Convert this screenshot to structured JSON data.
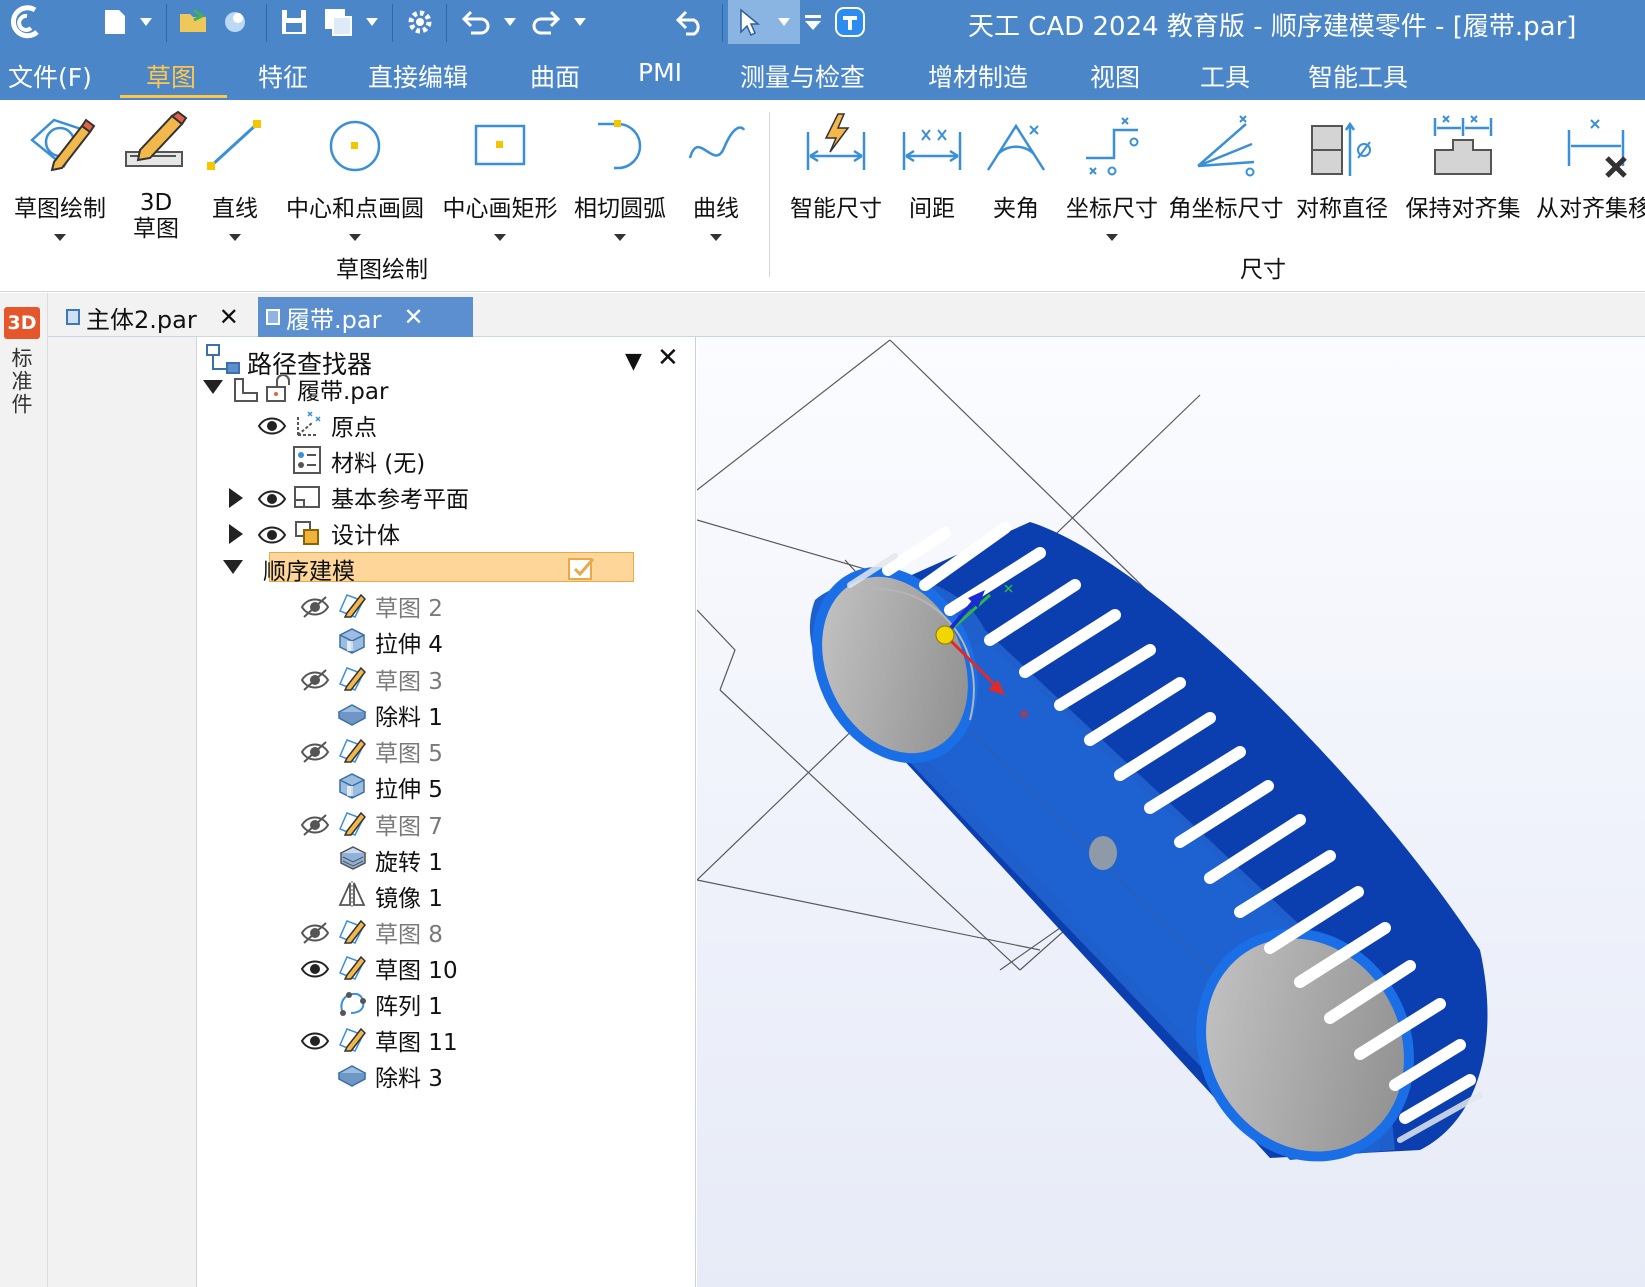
{
  "titlebar": {
    "title": "天工 CAD 2024 教育版 - 顺序建模零件 - [履带.par]",
    "icons": [
      "app-logo-icon",
      "new-file-icon",
      "open-file-icon",
      "shared-icon",
      "save-icon",
      "save-as-icon",
      "settings-icon",
      "undo-icon",
      "redo-icon",
      "return-icon",
      "select-pointer-icon",
      "customize-icon",
      "t-app-icon"
    ]
  },
  "menu": {
    "items": [
      "文件(F)",
      "草图",
      "特征",
      "直接编辑",
      "曲面",
      "PMI",
      "测量与检查",
      "增材制造",
      "视图",
      "工具",
      "智能工具"
    ],
    "active": "草图"
  },
  "ribbon": {
    "sketch_group": {
      "label": "草图绘制",
      "tools": [
        {
          "label": "草图绘制",
          "icon": "sketch-draw-icon"
        },
        {
          "label": "3D\n草图",
          "icon": "3d-sketch-icon"
        },
        {
          "label": "直线",
          "icon": "line-icon"
        },
        {
          "label": "中心和点画圆",
          "icon": "circle-icon"
        },
        {
          "label": "中心画矩形",
          "icon": "rectangle-icon"
        },
        {
          "label": "相切圆弧",
          "icon": "tangent-arc-icon"
        },
        {
          "label": "曲线",
          "icon": "curve-icon"
        }
      ]
    },
    "dim_group": {
      "label": "尺寸",
      "tools": [
        {
          "label": "智能尺寸",
          "icon": "smart-dimension-icon"
        },
        {
          "label": "间距",
          "icon": "distance-icon"
        },
        {
          "label": "夹角",
          "icon": "angle-icon"
        },
        {
          "label": "坐标尺寸",
          "icon": "coordinate-dimension-icon"
        },
        {
          "label": "角坐标尺寸",
          "icon": "angular-coordinate-icon"
        },
        {
          "label": "对称直径",
          "icon": "symmetric-diameter-icon"
        },
        {
          "label": "保持对齐集",
          "icon": "keep-aligned-icon"
        },
        {
          "label": "从对齐集移",
          "icon": "remove-aligned-icon"
        }
      ]
    }
  },
  "side": {
    "badge": "3D",
    "label": "标准件"
  },
  "tabs": [
    {
      "label": "主体2.par",
      "close": "✕"
    },
    {
      "label": "履带.par",
      "close": "✕"
    }
  ],
  "pathfinder": {
    "title": "路径查找器",
    "pin": "▼",
    "close": "✕",
    "root": "履带.par",
    "items": {
      "origin": "原点",
      "material": "材料 (无)",
      "base_planes": "基本参考平面",
      "design_body": "设计体",
      "ordered": "顺序建模",
      "sketch2": "草图 2",
      "extrude4": "拉伸 4",
      "sketch3": "草图 3",
      "cut1": "除料 1",
      "sketch5": "草图 5",
      "extrude5": "拉伸 5",
      "sketch7": "草图 7",
      "revolve1": "旋转 1",
      "mirror1": "镜像 1",
      "sketch8": "草图 8",
      "sketch10": "草图 10",
      "pattern1": "阵列 1",
      "sketch11": "草图 11",
      "cut3": "除料 3"
    }
  },
  "colors": {
    "titlebar": "#4a86c8",
    "menu_active": "#ffc64c",
    "tab_active": "#5b8fd0",
    "model_blue": "#1f5fcc",
    "model_dark": "#0b3fb0",
    "selection": "#ffd699"
  }
}
